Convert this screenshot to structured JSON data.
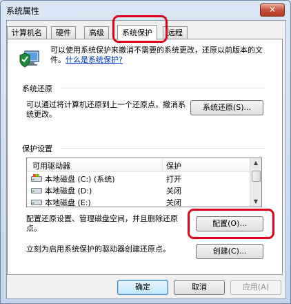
{
  "window": {
    "title": "系统属性",
    "close_glyph": "✕"
  },
  "tabs": [
    {
      "label": "计算机名"
    },
    {
      "label": "硬件"
    },
    {
      "label": "高级"
    },
    {
      "label": "系统保护",
      "active": true
    },
    {
      "label": "远程"
    }
  ],
  "intro": {
    "text": "可以使用系统保护来撤消不需要的系统更改，还原以前版本的文件。",
    "link": "什么是系统保护?"
  },
  "restore": {
    "group_title": "系统还原",
    "text": "可以通过将计算机还原到上一个还原点，撤消系统更改。",
    "button": "系统还原(S)..."
  },
  "protection": {
    "group_title": "保护设置",
    "columns": [
      "可用驱动器",
      "保护"
    ],
    "drives": [
      {
        "name": "本地磁盘 (C:) (系统)",
        "status": "打开",
        "icon": "system-drive-icon"
      },
      {
        "name": "本地磁盘 (D:)",
        "status": "关闭",
        "icon": "drive-icon"
      },
      {
        "name": "本地磁盘 (E:)",
        "status": "关闭",
        "icon": "drive-icon"
      }
    ],
    "config_text": "配置还原设置、管理磁盘空间，并且删除还原点。",
    "config_button": "配置(O)...",
    "create_text": "立刻为启用系统保护的驱动器创建还原点。",
    "create_button": "创建(C)..."
  },
  "footer": {
    "ok": "确定",
    "cancel": "取消",
    "apply": "应用(A)"
  },
  "colors": {
    "highlight": "#e0001b",
    "link": "#0033cc"
  }
}
